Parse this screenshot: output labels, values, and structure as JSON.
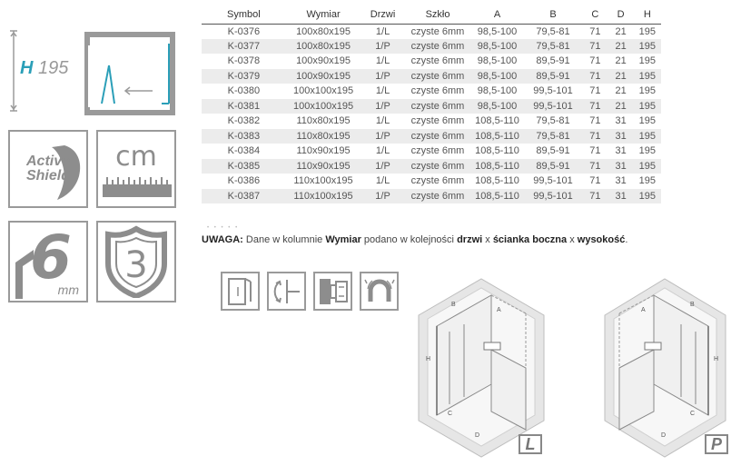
{
  "height_badge": {
    "prefix": "H",
    "value": "195"
  },
  "features": {
    "active_shield_line1": "Active",
    "active_shield_line2": "Shield",
    "cm_label": "cm",
    "glass_thickness": "6",
    "glass_unit": "mm",
    "warranty_years": "3"
  },
  "table": {
    "headers": [
      "Symbol",
      "Wymiar",
      "Drzwi",
      "Szkło",
      "A",
      "B",
      "C",
      "D",
      "H"
    ],
    "rows": [
      [
        "K-0376",
        "100x80x195",
        "1/L",
        "czyste 6mm",
        "98,5-100",
        "79,5-81",
        "71",
        "21",
        "195"
      ],
      [
        "K-0377",
        "100x80x195",
        "1/P",
        "czyste 6mm",
        "98,5-100",
        "79,5-81",
        "71",
        "21",
        "195"
      ],
      [
        "K-0378",
        "100x90x195",
        "1/L",
        "czyste 6mm",
        "98,5-100",
        "89,5-91",
        "71",
        "21",
        "195"
      ],
      [
        "K-0379",
        "100x90x195",
        "1/P",
        "czyste 6mm",
        "98,5-100",
        "89,5-91",
        "71",
        "21",
        "195"
      ],
      [
        "K-0380",
        "100x100x195",
        "1/L",
        "czyste 6mm",
        "98,5-100",
        "99,5-101",
        "71",
        "21",
        "195"
      ],
      [
        "K-0381",
        "100x100x195",
        "1/P",
        "czyste 6mm",
        "98,5-100",
        "99,5-101",
        "71",
        "21",
        "195"
      ],
      [
        "K-0382",
        "110x80x195",
        "1/L",
        "czyste 6mm",
        "108,5-110",
        "79,5-81",
        "71",
        "31",
        "195"
      ],
      [
        "K-0383",
        "110x80x195",
        "1/P",
        "czyste 6mm",
        "108,5-110",
        "79,5-81",
        "71",
        "31",
        "195"
      ],
      [
        "K-0384",
        "110x90x195",
        "1/L",
        "czyste 6mm",
        "108,5-110",
        "89,5-91",
        "71",
        "31",
        "195"
      ],
      [
        "K-0385",
        "110x90x195",
        "1/P",
        "czyste 6mm",
        "108,5-110",
        "89,5-91",
        "71",
        "31",
        "195"
      ],
      [
        "K-0386",
        "110x100x195",
        "1/L",
        "czyste 6mm",
        "108,5-110",
        "99,5-101",
        "71",
        "31",
        "195"
      ],
      [
        "K-0387",
        "110x100x195",
        "1/P",
        "czyste 6mm",
        "108,5-110",
        "99,5-101",
        "71",
        "31",
        "195"
      ]
    ]
  },
  "note": {
    "label": "UWAGA:",
    "text1": " Dane w kolumnie ",
    "bold1": "Wymiar",
    "text2": " podano w kolejności ",
    "bold2": "drzwi",
    "text3": " x ",
    "bold3": "ścianka boczna",
    "text4": " x ",
    "bold4": "wysokość",
    "text5": "."
  },
  "diagram_labels": {
    "A": "A",
    "B": "B",
    "C": "C",
    "D": "D",
    "H": "H"
  },
  "badges": {
    "left": "L",
    "right": "P"
  },
  "colors": {
    "accent": "#2b9fb8",
    "icon_gray": "#8d8d8d",
    "row_stripe": "#ececec"
  }
}
